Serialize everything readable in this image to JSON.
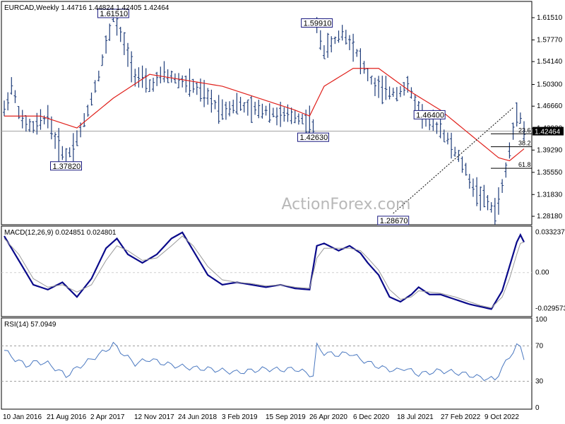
{
  "header": {
    "title": "EURCAD,Weekly  1.44716 1.44824 1.42405 1.42464"
  },
  "watermark": "ActionForex.com",
  "colors": {
    "bar": "#1f3d7a",
    "ma": "#e0201b",
    "macd": "#0a0a8a",
    "signal": "#9a9a9a",
    "rsi": "#4a78c0",
    "grid": "#cfcfcf",
    "level_fill": "#ffffff"
  },
  "chart_data": [
    {
      "type": "ohlc",
      "pane": "price",
      "ylim": [
        1.27,
        1.64
      ],
      "y_ticks": [
        1.2818,
        1.3183,
        1.3555,
        1.3929,
        1.4293,
        1.4666,
        1.503,
        1.5414,
        1.5777,
        1.6151
      ],
      "y_tick_labels": [
        "1.28180",
        "1.31830",
        "1.35550",
        "1.39290",
        "1.42930",
        "1.46660",
        "1.50300",
        "1.54140",
        "1.57770",
        "1.61510"
      ],
      "current_price": 1.42464,
      "current_price_label": "1.42464",
      "x_labels": [
        "10 Jan 2016",
        "21 Aug 2016",
        "2 Apr 2017",
        "12 Nov 2017",
        "24 Jun 2018",
        "3 Feb 2019",
        "15 Sep 2019",
        "26 Apr 2020",
        "6 Dec 2020",
        "18 Jul 2021",
        "27 Feb 2022",
        "9 Oct 2022"
      ],
      "key_points": [
        {
          "label": "1.61510",
          "week": 30,
          "value": 1.6151
        },
        {
          "label": "1.37820",
          "week": 17,
          "value": 1.3782
        },
        {
          "label": "1.59910",
          "week": 86,
          "value": 1.5991
        },
        {
          "label": "1.42630",
          "week": 85,
          "value": 1.4263
        },
        {
          "label": "1.28670",
          "week": 107,
          "value": 1.2867
        },
        {
          "label": "1.46400",
          "week": 117,
          "value": 1.464
        }
      ],
      "fib_levels": [
        {
          "label": "23.6",
          "value": 1.4202
        },
        {
          "label": "38.2",
          "value": 1.3985
        },
        {
          "label": "61.8",
          "value": 1.3624
        }
      ],
      "price_path": [
        [
          0,
          1.46
        ],
        [
          2,
          1.5
        ],
        [
          5,
          1.44
        ],
        [
          8,
          1.43
        ],
        [
          12,
          1.45
        ],
        [
          14,
          1.41
        ],
        [
          17,
          1.38
        ],
        [
          19,
          1.4
        ],
        [
          22,
          1.44
        ],
        [
          26,
          1.52
        ],
        [
          30,
          1.615
        ],
        [
          33,
          1.57
        ],
        [
          36,
          1.52
        ],
        [
          40,
          1.5
        ],
        [
          44,
          1.52
        ],
        [
          48,
          1.51
        ],
        [
          52,
          1.5
        ],
        [
          56,
          1.48
        ],
        [
          60,
          1.46
        ],
        [
          64,
          1.47
        ],
        [
          68,
          1.46
        ],
        [
          72,
          1.46
        ],
        [
          76,
          1.45
        ],
        [
          80,
          1.45
        ],
        [
          84,
          1.44
        ],
        [
          85,
          1.426
        ],
        [
          86,
          1.599
        ],
        [
          88,
          1.56
        ],
        [
          90,
          1.57
        ],
        [
          93,
          1.59
        ],
        [
          96,
          1.57
        ],
        [
          99,
          1.53
        ],
        [
          102,
          1.5
        ],
        [
          105,
          1.49
        ],
        [
          108,
          1.49
        ],
        [
          111,
          1.5
        ],
        [
          114,
          1.46
        ],
        [
          117,
          1.44
        ],
        [
          120,
          1.43
        ],
        [
          123,
          1.4
        ],
        [
          126,
          1.37
        ],
        [
          129,
          1.33
        ],
        [
          132,
          1.31
        ],
        [
          135,
          1.29
        ],
        [
          137,
          1.33
        ],
        [
          139,
          1.39
        ],
        [
          141,
          1.46
        ],
        [
          142,
          1.45
        ],
        [
          143,
          1.424
        ]
      ],
      "ma_path": [
        [
          0,
          1.45
        ],
        [
          10,
          1.45
        ],
        [
          20,
          1.43
        ],
        [
          30,
          1.48
        ],
        [
          40,
          1.52
        ],
        [
          50,
          1.51
        ],
        [
          60,
          1.5
        ],
        [
          70,
          1.48
        ],
        [
          80,
          1.46
        ],
        [
          84,
          1.45
        ],
        [
          88,
          1.5
        ],
        [
          96,
          1.53
        ],
        [
          103,
          1.53
        ],
        [
          112,
          1.49
        ],
        [
          120,
          1.46
        ],
        [
          126,
          1.43
        ],
        [
          132,
          1.4
        ],
        [
          136,
          1.38
        ],
        [
          139,
          1.375
        ],
        [
          141,
          1.385
        ],
        [
          143,
          1.395
        ]
      ]
    },
    {
      "type": "line",
      "pane": "macd",
      "title": "MACD(12,26,9) 0.024851 0.024801",
      "ylim": [
        -0.035,
        0.037
      ],
      "y_ticks": [
        0.033237,
        0.0,
        -0.029573
      ],
      "y_tick_labels": [
        "0.033237",
        "0.00",
        "-0.029573"
      ],
      "series": [
        {
          "name": "MACD",
          "values": [
            [
              0,
              0.03
            ],
            [
              4,
              0.01
            ],
            [
              8,
              -0.01
            ],
            [
              12,
              -0.014
            ],
            [
              16,
              -0.008
            ],
            [
              20,
              -0.02
            ],
            [
              24,
              -0.005
            ],
            [
              28,
              0.02
            ],
            [
              31,
              0.028
            ],
            [
              34,
              0.015
            ],
            [
              38,
              0.008
            ],
            [
              42,
              0.015
            ],
            [
              46,
              0.028
            ],
            [
              49,
              0.033
            ],
            [
              52,
              0.018
            ],
            [
              56,
              -0.002
            ],
            [
              60,
              -0.01
            ],
            [
              64,
              -0.008
            ],
            [
              68,
              -0.01
            ],
            [
              72,
              -0.012
            ],
            [
              76,
              -0.01
            ],
            [
              80,
              -0.013
            ],
            [
              84,
              -0.014
            ],
            [
              86,
              0.022
            ],
            [
              88,
              0.024
            ],
            [
              92,
              0.018
            ],
            [
              95,
              0.022
            ],
            [
              98,
              0.016
            ],
            [
              100,
              0.008
            ],
            [
              103,
              -0.002
            ],
            [
              106,
              -0.02
            ],
            [
              109,
              -0.024
            ],
            [
              112,
              -0.018
            ],
            [
              114,
              -0.012
            ],
            [
              117,
              -0.018
            ],
            [
              120,
              -0.018
            ],
            [
              124,
              -0.022
            ],
            [
              128,
              -0.026
            ],
            [
              131,
              -0.028
            ],
            [
              134,
              -0.03
            ],
            [
              137,
              -0.015
            ],
            [
              139,
              0.005
            ],
            [
              141,
              0.025
            ],
            [
              142,
              0.031
            ],
            [
              143,
              0.025
            ]
          ]
        },
        {
          "name": "Signal",
          "values": [
            [
              0,
              0.028
            ],
            [
              4,
              0.015
            ],
            [
              8,
              -0.005
            ],
            [
              12,
              -0.012
            ],
            [
              16,
              -0.01
            ],
            [
              20,
              -0.016
            ],
            [
              24,
              -0.01
            ],
            [
              28,
              0.01
            ],
            [
              31,
              0.022
            ],
            [
              34,
              0.018
            ],
            [
              38,
              0.01
            ],
            [
              42,
              0.012
            ],
            [
              46,
              0.022
            ],
            [
              49,
              0.03
            ],
            [
              52,
              0.022
            ],
            [
              56,
              0.005
            ],
            [
              60,
              -0.006
            ],
            [
              64,
              -0.008
            ],
            [
              68,
              -0.009
            ],
            [
              72,
              -0.011
            ],
            [
              76,
              -0.01
            ],
            [
              80,
              -0.012
            ],
            [
              84,
              -0.013
            ],
            [
              86,
              0.012
            ],
            [
              88,
              0.02
            ],
            [
              92,
              0.02
            ],
            [
              95,
              0.02
            ],
            [
              98,
              0.018
            ],
            [
              100,
              0.012
            ],
            [
              103,
              0.002
            ],
            [
              106,
              -0.014
            ],
            [
              109,
              -0.022
            ],
            [
              112,
              -0.02
            ],
            [
              114,
              -0.015
            ],
            [
              117,
              -0.016
            ],
            [
              120,
              -0.017
            ],
            [
              124,
              -0.02
            ],
            [
              128,
              -0.024
            ],
            [
              131,
              -0.027
            ],
            [
              134,
              -0.029
            ],
            [
              137,
              -0.02
            ],
            [
              139,
              -0.005
            ],
            [
              141,
              0.015
            ],
            [
              142,
              0.024
            ],
            [
              143,
              0.025
            ]
          ]
        }
      ]
    },
    {
      "type": "line",
      "pane": "rsi",
      "title": "RSI(14) 57.0949",
      "ylim": [
        0,
        100
      ],
      "y_ticks": [
        100,
        70,
        30,
        0
      ],
      "y_tick_labels": [
        "100",
        "70",
        "30",
        "0"
      ],
      "levels": [
        70,
        30
      ],
      "series": [
        {
          "name": "RSI",
          "values": [
            [
              0,
              65
            ],
            [
              3,
              55
            ],
            [
              6,
              48
            ],
            [
              9,
              52
            ],
            [
              12,
              50
            ],
            [
              15,
              42
            ],
            [
              17,
              36
            ],
            [
              20,
              45
            ],
            [
              24,
              55
            ],
            [
              28,
              65
            ],
            [
              30,
              72
            ],
            [
              33,
              60
            ],
            [
              36,
              50
            ],
            [
              40,
              55
            ],
            [
              44,
              50
            ],
            [
              48,
              47
            ],
            [
              52,
              45
            ],
            [
              56,
              44
            ],
            [
              60,
              42
            ],
            [
              64,
              40
            ],
            [
              68,
              42
            ],
            [
              72,
              44
            ],
            [
              76,
              43
            ],
            [
              80,
              44
            ],
            [
              84,
              38
            ],
            [
              85,
              36
            ],
            [
              86,
              70
            ],
            [
              88,
              62
            ],
            [
              92,
              60
            ],
            [
              95,
              62
            ],
            [
              98,
              55
            ],
            [
              102,
              48
            ],
            [
              105,
              44
            ],
            [
              108,
              42
            ],
            [
              110,
              45
            ],
            [
              114,
              38
            ],
            [
              117,
              40
            ],
            [
              120,
              42
            ],
            [
              124,
              40
            ],
            [
              127,
              38
            ],
            [
              130,
              35
            ],
            [
              133,
              33
            ],
            [
              135,
              32
            ],
            [
              137,
              45
            ],
            [
              139,
              58
            ],
            [
              141,
              70
            ],
            [
              142,
              68
            ],
            [
              143,
              57
            ]
          ]
        }
      ]
    }
  ]
}
